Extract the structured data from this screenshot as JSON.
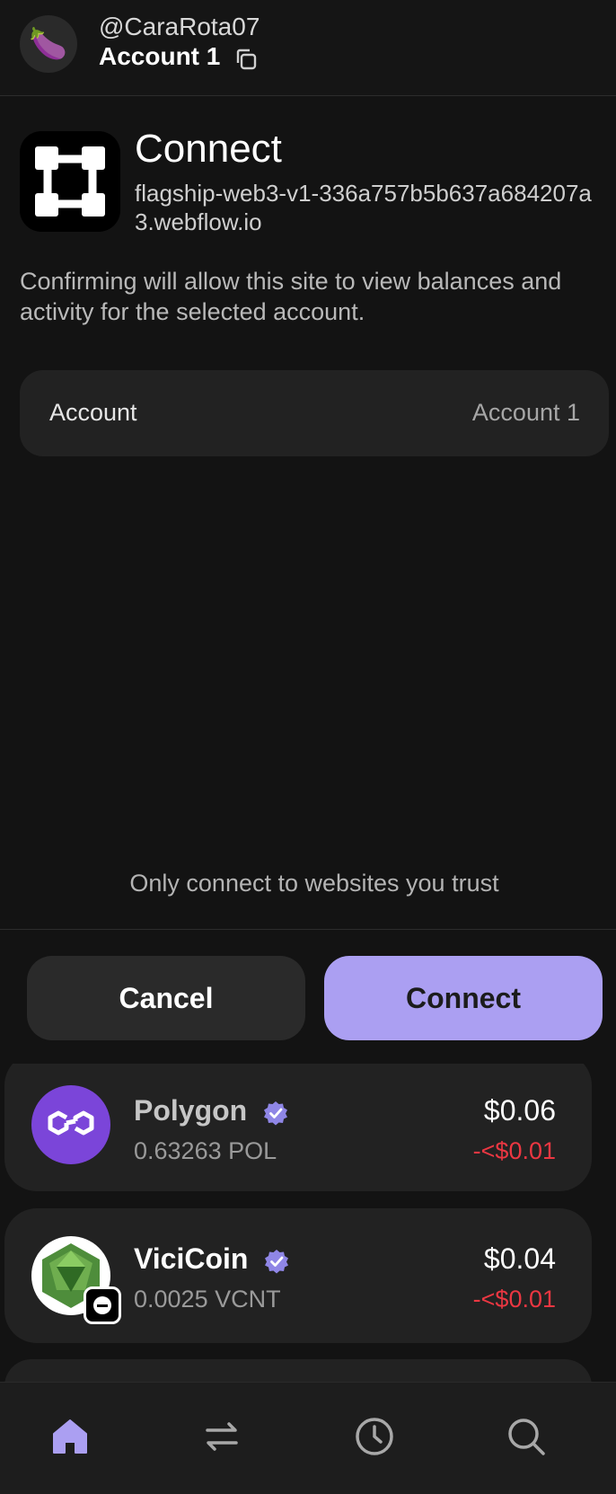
{
  "header": {
    "avatar_emoji": "🍆",
    "username": "@CaraRota07",
    "account_name": "Account 1"
  },
  "connect": {
    "title": "Connect",
    "site_url": "flagship-web3-v1-336a757b5b637a684207a3.webflow.io",
    "description": "Confirming will allow this site to view balances and activity for the selected account.",
    "account_label": "Account",
    "account_value": "Account 1",
    "trust_note": "Only connect to websites you trust",
    "cancel_label": "Cancel",
    "connect_label": "Connect"
  },
  "tokens": [
    {
      "name": "Polygon",
      "amount": "0.63263 POL",
      "value": "$0.06",
      "change": "-<$0.01",
      "icon": "polygon-icon"
    },
    {
      "name": "ViciCoin",
      "amount": "0.0025 VCNT",
      "value": "$0.04",
      "change": "-<$0.01",
      "icon": "vicicoin-icon"
    }
  ],
  "nav": [
    "home-icon",
    "swap-icon",
    "history-icon",
    "search-icon"
  ],
  "colors": {
    "background": "#131313",
    "card": "#222222",
    "accent": "#ab9ff2",
    "negative": "#eb3742",
    "verified": "#8f86e6"
  }
}
